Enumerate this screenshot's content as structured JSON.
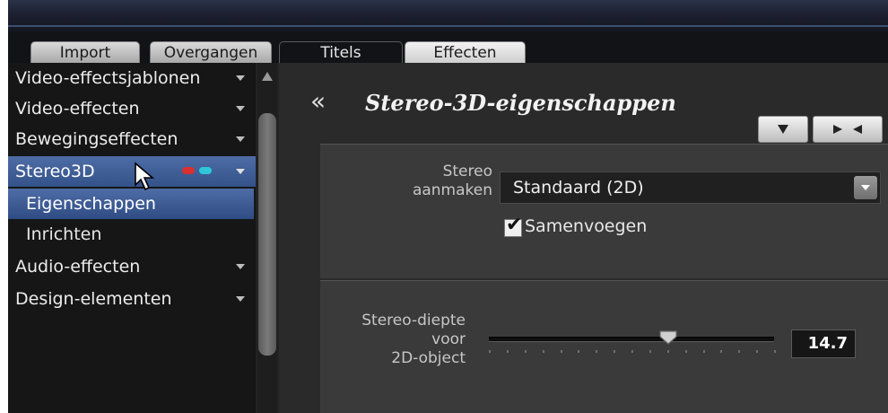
{
  "tabs": [
    {
      "label": "Import"
    },
    {
      "label": "Overgangen"
    },
    {
      "label": "Titels"
    },
    {
      "label": "Effecten"
    }
  ],
  "sidebar": {
    "items": [
      {
        "label": "Video-effectsjablonen"
      },
      {
        "label": "Video-effecten"
      },
      {
        "label": "Bewegingseffecten"
      },
      {
        "label": "Stereo3D"
      },
      {
        "label": "Eigenschappen"
      },
      {
        "label": "Inrichten"
      },
      {
        "label": "Audio-effecten"
      },
      {
        "label": "Design-elementen"
      }
    ]
  },
  "panel": {
    "title": "Stereo-3D-eigenschappen"
  },
  "stereo_create": {
    "label_line1": "Stereo",
    "label_line2": "aanmaken",
    "selected": "Standaard (2D)",
    "merge_label": "Samenvoegen",
    "merge_checked": true
  },
  "depth": {
    "label_line1": "Stereo-diepte",
    "label_line2": "voor",
    "label_line3": "2D-object",
    "value": "14.7",
    "slider_fraction": 0.63
  },
  "colors": {
    "selection": "#3f5d97",
    "anaglyph_red": "#d93030",
    "anaglyph_cyan": "#2fc6d8"
  }
}
